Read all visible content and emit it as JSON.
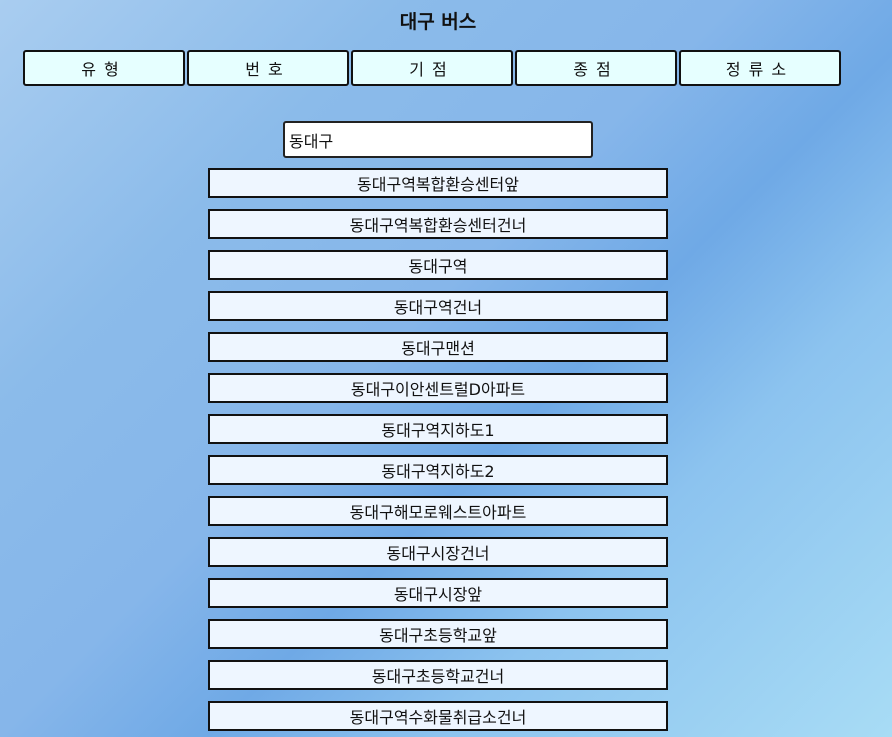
{
  "header": {
    "title": "대구 버스"
  },
  "tabs": [
    {
      "label": "유형"
    },
    {
      "label": "번호"
    },
    {
      "label": "기점"
    },
    {
      "label": "종점"
    },
    {
      "label": "정류소"
    }
  ],
  "search": {
    "value": "동대구"
  },
  "results": [
    {
      "label": "동대구역복합환승센터앞"
    },
    {
      "label": "동대구역복합환승센터건너"
    },
    {
      "label": "동대구역"
    },
    {
      "label": "동대구역건너"
    },
    {
      "label": "동대구맨션"
    },
    {
      "label": "동대구이안센트럴D아파트"
    },
    {
      "label": "동대구역지하도1"
    },
    {
      "label": "동대구역지하도2"
    },
    {
      "label": "동대구해모로웨스트아파트"
    },
    {
      "label": "동대구시장건너"
    },
    {
      "label": "동대구시장앞"
    },
    {
      "label": "동대구초등학교앞"
    },
    {
      "label": "동대구초등학교건너"
    },
    {
      "label": "동대구역수화물취급소건너"
    }
  ]
}
